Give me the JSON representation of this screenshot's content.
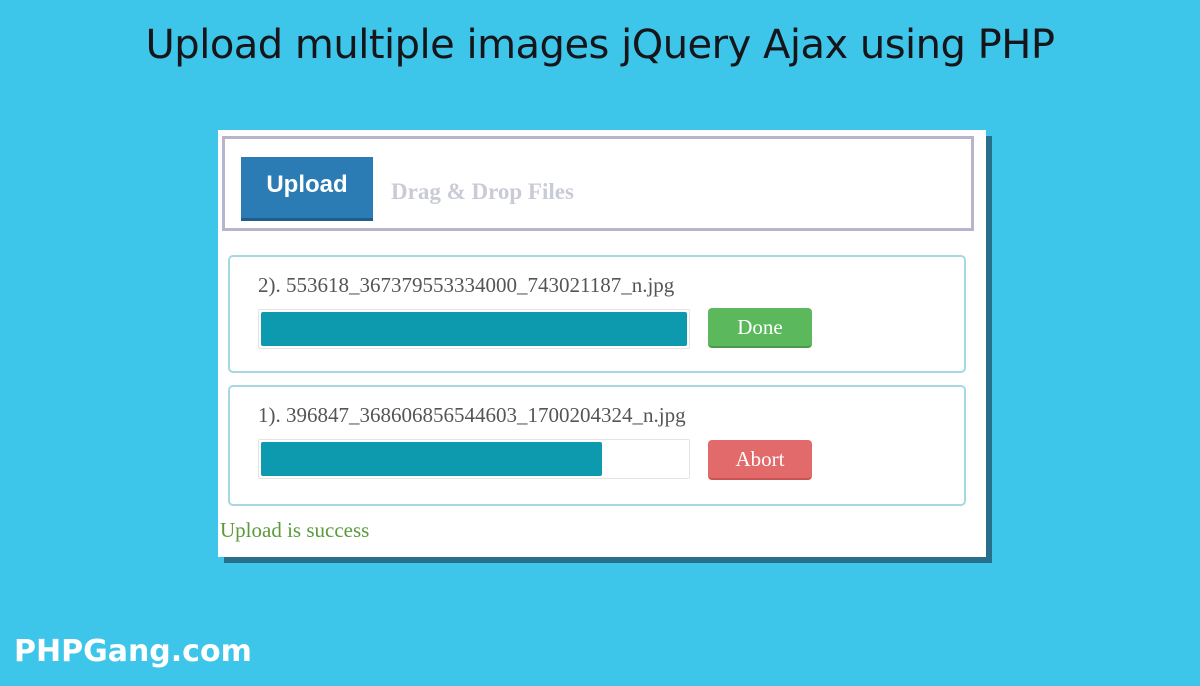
{
  "headline": "Upload multiple images jQuery Ajax using PHP",
  "uploader": {
    "upload_button_label": "Upload",
    "drop_hint": "Drag & Drop Files",
    "files": [
      {
        "name": "2). 553618_367379553334000_743021187_n.jpg",
        "progress_percent": 100,
        "action_label": "Done",
        "action_color": "#5cb85c"
      },
      {
        "name": "1). 396847_368606856544603_1700204324_n.jpg",
        "progress_percent": 80,
        "action_label": "Abort",
        "action_color": "#e36a6a"
      }
    ],
    "status_message": "Upload is success"
  },
  "watermark": "PHPGang.com",
  "colors": {
    "background": "#3ec5ea",
    "upload_button": "#2b7bb4",
    "progress_fill": "#0d9aae",
    "success_text": "#5a9a3a"
  }
}
